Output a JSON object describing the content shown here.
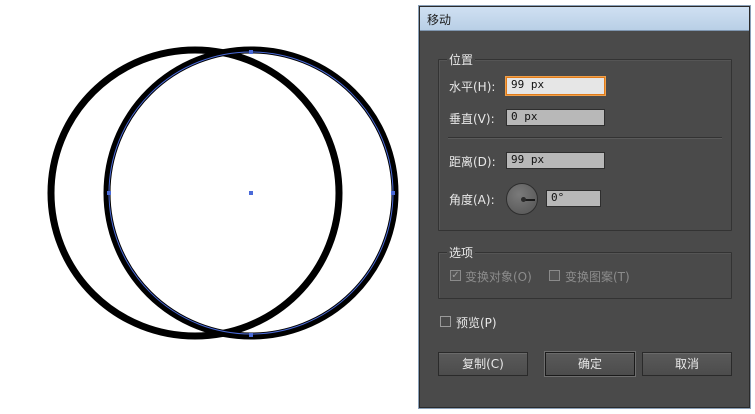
{
  "dialog": {
    "title": "移动",
    "position_group": {
      "title": "位置",
      "horizontal": {
        "label": "水平(H):",
        "value": "99 px"
      },
      "vertical": {
        "label": "垂直(V):",
        "value": "0 px"
      },
      "distance": {
        "label": "距离(D):",
        "value": "99 px"
      },
      "angle": {
        "label": "角度(A):",
        "value": "0°"
      }
    },
    "options_group": {
      "title": "选项",
      "transform_objects": {
        "label": "变换对象(O)",
        "checked": true,
        "enabled": false
      },
      "transform_patterns": {
        "label": "变换图案(T)",
        "checked": false,
        "enabled": false
      }
    },
    "preview": {
      "label": "预览(P)",
      "checked": false
    },
    "buttons": {
      "copy": "复制(C)",
      "ok": "确定",
      "cancel": "取消"
    }
  },
  "canvas": {
    "stroke_color": "#000000",
    "selection_color": "#4a6ad8"
  }
}
